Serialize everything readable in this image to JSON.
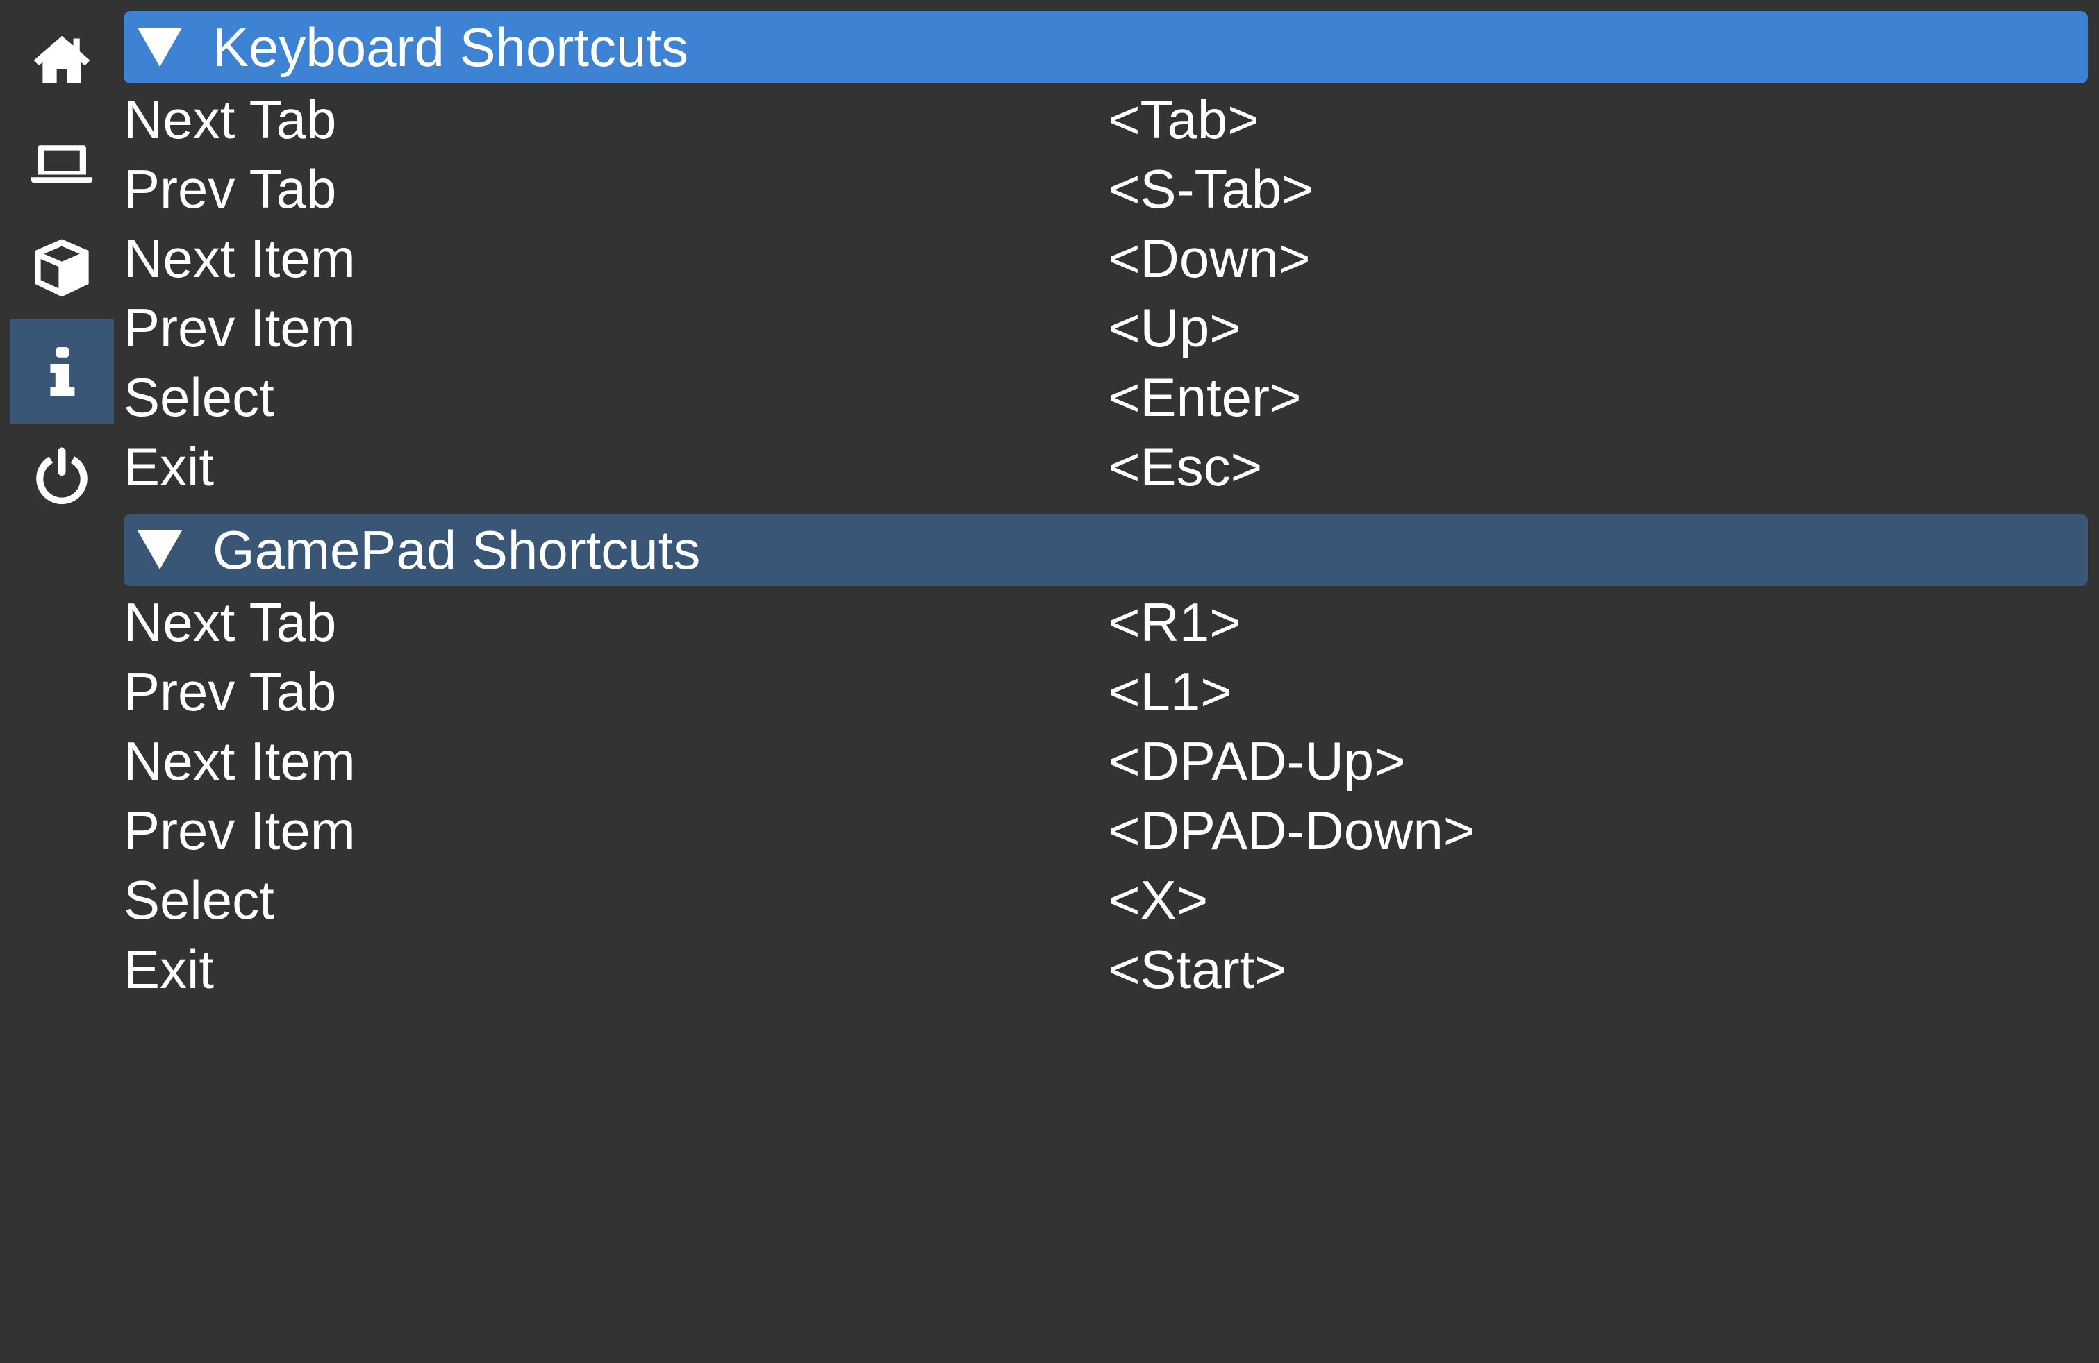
{
  "colors": {
    "background": "#333333",
    "header_active": "#3e82d3",
    "header_inactive": "#3a5677",
    "sidebar_active": "#3a5677",
    "text": "#ffffff"
  },
  "sidebar": {
    "items": [
      {
        "icon": "home-icon",
        "active": false
      },
      {
        "icon": "laptop-icon",
        "active": false
      },
      {
        "icon": "cube-icon",
        "active": false
      },
      {
        "icon": "info-icon",
        "active": true
      },
      {
        "icon": "power-icon",
        "active": false
      }
    ]
  },
  "sections": [
    {
      "title": "Keyboard Shortcuts",
      "expanded": true,
      "rows": [
        {
          "action": "Next Tab",
          "key": "<Tab>"
        },
        {
          "action": "Prev Tab",
          "key": "<S-Tab>"
        },
        {
          "action": "Next Item",
          "key": "<Down>"
        },
        {
          "action": "Prev Item",
          "key": "<Up>"
        },
        {
          "action": "Select",
          "key": "<Enter>"
        },
        {
          "action": "Exit",
          "key": "<Esc>"
        }
      ]
    },
    {
      "title": "GamePad Shortcuts",
      "expanded": true,
      "rows": [
        {
          "action": "Next Tab",
          "key": "<R1>"
        },
        {
          "action": "Prev Tab",
          "key": "<L1>"
        },
        {
          "action": "Next Item",
          "key": "<DPAD-Up>"
        },
        {
          "action": "Prev Item",
          "key": "<DPAD-Down>"
        },
        {
          "action": "Select",
          "key": "<X>"
        },
        {
          "action": "Exit",
          "key": "<Start>"
        }
      ]
    }
  ]
}
